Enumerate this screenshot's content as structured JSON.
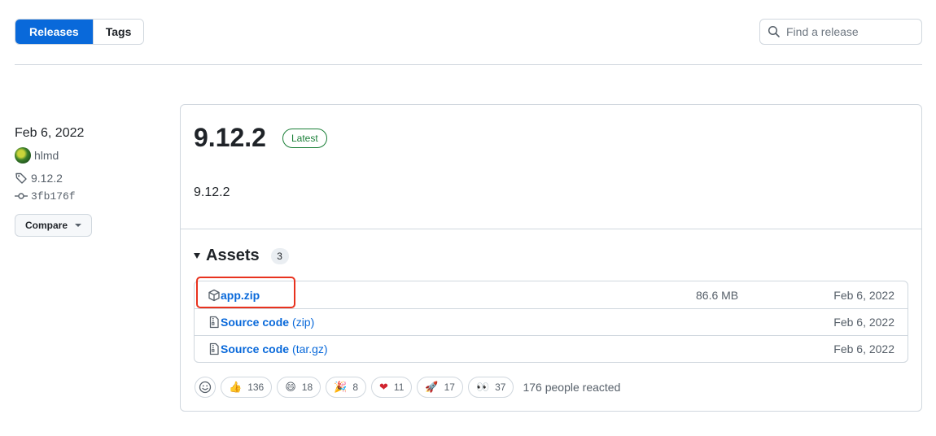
{
  "tabs": [
    {
      "label": "Releases",
      "active": true
    },
    {
      "label": "Tags",
      "active": false
    }
  ],
  "search": {
    "placeholder": "Find a release",
    "value": ""
  },
  "release_meta": {
    "date": "Feb 6, 2022",
    "author": "hlmd",
    "tag": "9.12.2",
    "commit": "3fb176f",
    "compare_label": "Compare"
  },
  "release": {
    "title": "9.12.2",
    "badge": "Latest",
    "body": "9.12.2"
  },
  "assets": {
    "title": "Assets",
    "count": "3",
    "items": [
      {
        "name": "app.zip",
        "suffix": "",
        "size": "86.6 MB",
        "date": "Feb 6, 2022",
        "icon": "package-icon"
      },
      {
        "name": "Source code",
        "suffix": "(zip)",
        "size": "",
        "date": "Feb 6, 2022",
        "icon": "file-zip-icon"
      },
      {
        "name": "Source code",
        "suffix": "(tar.gz)",
        "size": "",
        "date": "Feb 6, 2022",
        "icon": "file-zip-icon"
      }
    ]
  },
  "reactions": {
    "items": [
      {
        "emoji": "👍",
        "count": "136"
      },
      {
        "emoji": "😄",
        "count": "18"
      },
      {
        "emoji": "🎉",
        "count": "8"
      },
      {
        "emoji": "❤",
        "count": "11"
      },
      {
        "emoji": "🚀",
        "count": "17"
      },
      {
        "emoji": "👀",
        "count": "37"
      }
    ],
    "summary": "176 people reacted"
  },
  "colors": {
    "accent": "#0969da",
    "latest": "#1a7f37",
    "highlight": "#e8321e"
  }
}
